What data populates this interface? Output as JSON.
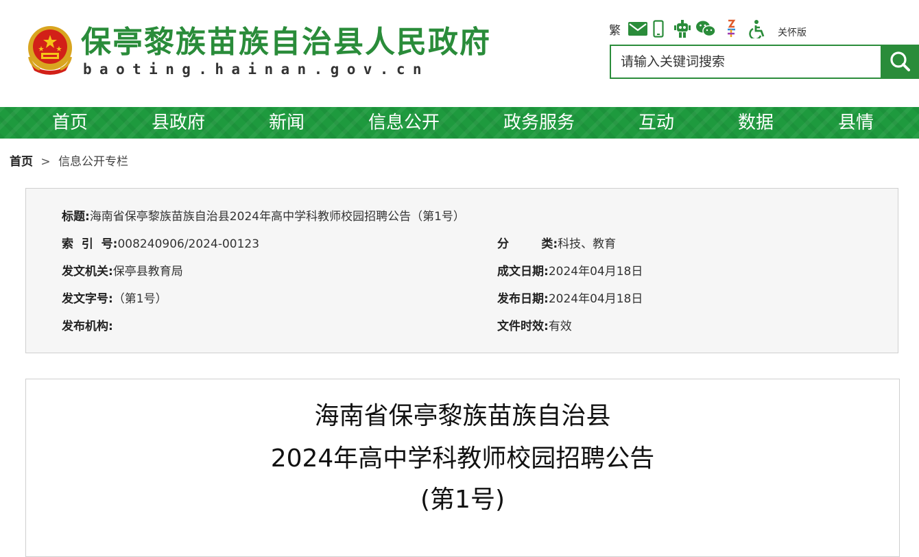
{
  "header": {
    "site_title": "保亭黎族苗族自治县人民政府",
    "site_domain": "baoting.hainan.gov.cn",
    "traditional_label": "繁",
    "care_mode_label": "关怀版",
    "search": {
      "placeholder": "请输入关键词搜索"
    }
  },
  "nav": {
    "items": [
      {
        "label": "首页"
      },
      {
        "label": "县政府"
      },
      {
        "label": "新闻"
      },
      {
        "label": "信息公开"
      },
      {
        "label": "政务服务"
      },
      {
        "label": "互动"
      },
      {
        "label": "数据"
      },
      {
        "label": "县情"
      }
    ]
  },
  "breadcrumb": {
    "home": "首页",
    "separator": ">",
    "current": "信息公开专栏"
  },
  "meta": {
    "title_label": "标题:",
    "title_value": "海南省保亭黎族苗族自治县2024年高中学科教师校园招聘公告（第1号）",
    "index_label": "索  引  号:",
    "index_value": "008240906/2024-00123",
    "category_label": "分        类:",
    "category_value": "科技、教育",
    "issuer_label": "发文机关:",
    "issuer_value": "保亭县教育局",
    "created_label": "成文日期:",
    "created_value": "2024年04月18日",
    "doc_no_label": "发文字号:",
    "doc_no_value": "（第1号）",
    "published_label": "发布日期:",
    "published_value": "2024年04月18日",
    "publisher_label": "发布机构:",
    "publisher_value": "",
    "validity_label": "文件时效:",
    "validity_value": "有效"
  },
  "article": {
    "title_line1": "海南省保亭黎族苗族自治县",
    "title_line2": "2024年高中学科教师校园招聘公告",
    "title_line3": "(第1号)"
  },
  "colors": {
    "brand_green": "#2a8c3a",
    "nav_green": "#1e9a3e"
  },
  "icons": [
    "national-emblem",
    "mail-icon",
    "mobile-icon",
    "robot-icon",
    "wechat-icon",
    "app-icon",
    "accessibility-icon",
    "search-icon"
  ]
}
